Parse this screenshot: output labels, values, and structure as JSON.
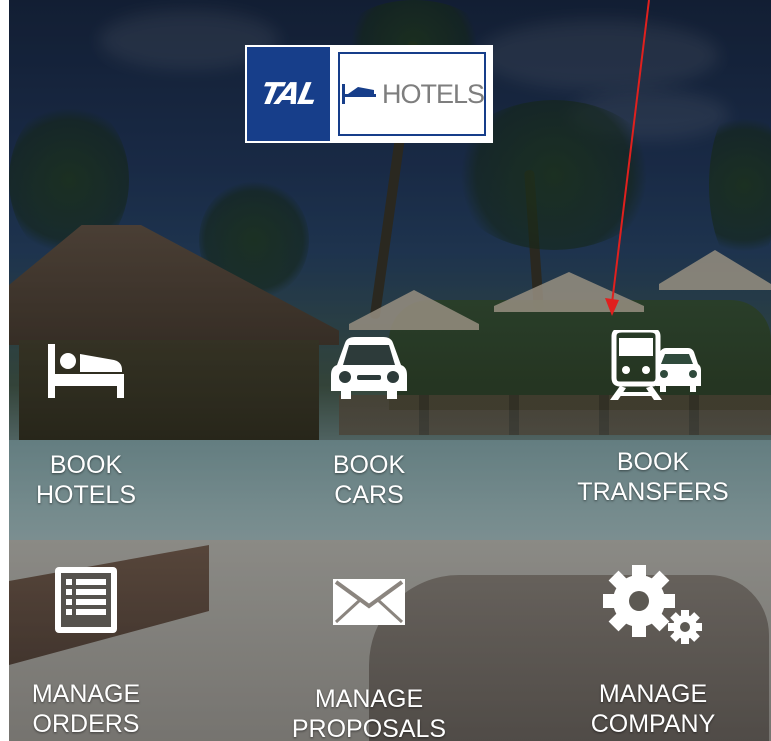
{
  "logo": {
    "left_text": "TAL",
    "right_text": "HOTELS",
    "colors": {
      "brand_blue": "#173e8a",
      "text_grey": "#7e7e7e"
    }
  },
  "menu": [
    {
      "line1": "BOOK",
      "line2": "HOTELS",
      "icon": "bed-icon"
    },
    {
      "line1": "BOOK",
      "line2": "CARS",
      "icon": "car-icon"
    },
    {
      "line1": "BOOK",
      "line2": "TRANSFERS",
      "icon": "train-car-icon"
    },
    {
      "line1": "MANAGE",
      "line2": "ORDERS",
      "icon": "list-icon"
    },
    {
      "line1": "MANAGE",
      "line2": "PROPOSALS",
      "icon": "envelope-icon"
    },
    {
      "line1": "MANAGE",
      "line2": "COMPANY",
      "icon": "gears-icon"
    }
  ],
  "annotation": {
    "color": "#e0201e"
  }
}
